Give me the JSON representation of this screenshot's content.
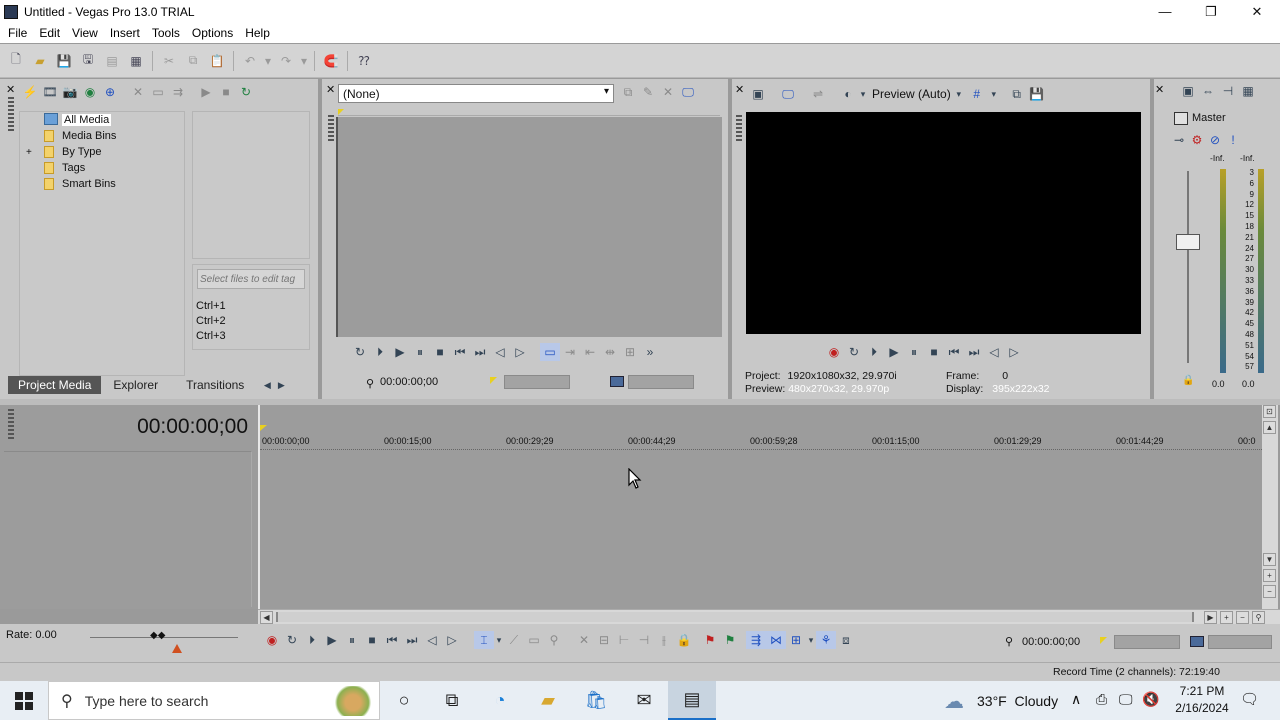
{
  "window": {
    "title": "Untitled - Vegas Pro 13.0 TRIAL",
    "minimize": "—",
    "maximize": "❐",
    "close": "✕"
  },
  "menu": [
    "File",
    "Edit",
    "View",
    "Insert",
    "Tools",
    "Options",
    "Help"
  ],
  "explorer": {
    "tree": [
      {
        "label": "All Media",
        "selected": true
      },
      {
        "label": "Media Bins"
      },
      {
        "label": "By Type",
        "expander": "+"
      },
      {
        "label": "Tags"
      },
      {
        "label": "Smart Bins"
      }
    ],
    "tag_placeholder": "Select files to edit tag",
    "shortcuts": [
      "Ctrl+1",
      "Ctrl+2",
      "Ctrl+3"
    ],
    "tabs": [
      "Project Media",
      "Explorer",
      "Transitions"
    ]
  },
  "trimmer": {
    "dropdown_value": "(None)",
    "timecode": "00:00:00;00"
  },
  "preview": {
    "mode": "Preview (Auto)",
    "project_label": "Project:",
    "project_value": "1920x1080x32, 29.970i",
    "preview_label": "Preview:",
    "preview_value": "480x270x32, 29.970p",
    "frame_label": "Frame:",
    "frame_value": "0",
    "display_label": "Display:",
    "display_value": "395x222x32"
  },
  "master": {
    "title": "Master",
    "inf_left": "-Inf.",
    "inf_right": "-Inf.",
    "scale": [
      "3",
      "6",
      "9",
      "12",
      "15",
      "18",
      "21",
      "24",
      "27",
      "30",
      "33",
      "36",
      "39",
      "42",
      "45",
      "48",
      "51",
      "54",
      "57"
    ],
    "level_left": "0.0",
    "level_right": "0.0"
  },
  "timeline": {
    "timecode": "00:00:00;00",
    "ruler": [
      "00:00:00;00",
      "00:00:15;00",
      "00:00:29;29",
      "00:00:44;29",
      "00:00:59;28",
      "00:01:15;00",
      "00:01:29;29",
      "00:01:44;29",
      "00:0"
    ],
    "rate": "Rate: 0.00",
    "transport_timecode": "00:00:00;00"
  },
  "status": {
    "record_time": "Record Time (2 channels): 72:19:40"
  },
  "taskbar": {
    "search_placeholder": "Type here to search",
    "weather": "33°F  Cloudy",
    "time": "7:21 PM",
    "date": "2/16/2024"
  },
  "colors": {
    "panel": "#c8c8c8",
    "timeline_bg": "#9a9a9a",
    "accent": "#2050c0"
  }
}
